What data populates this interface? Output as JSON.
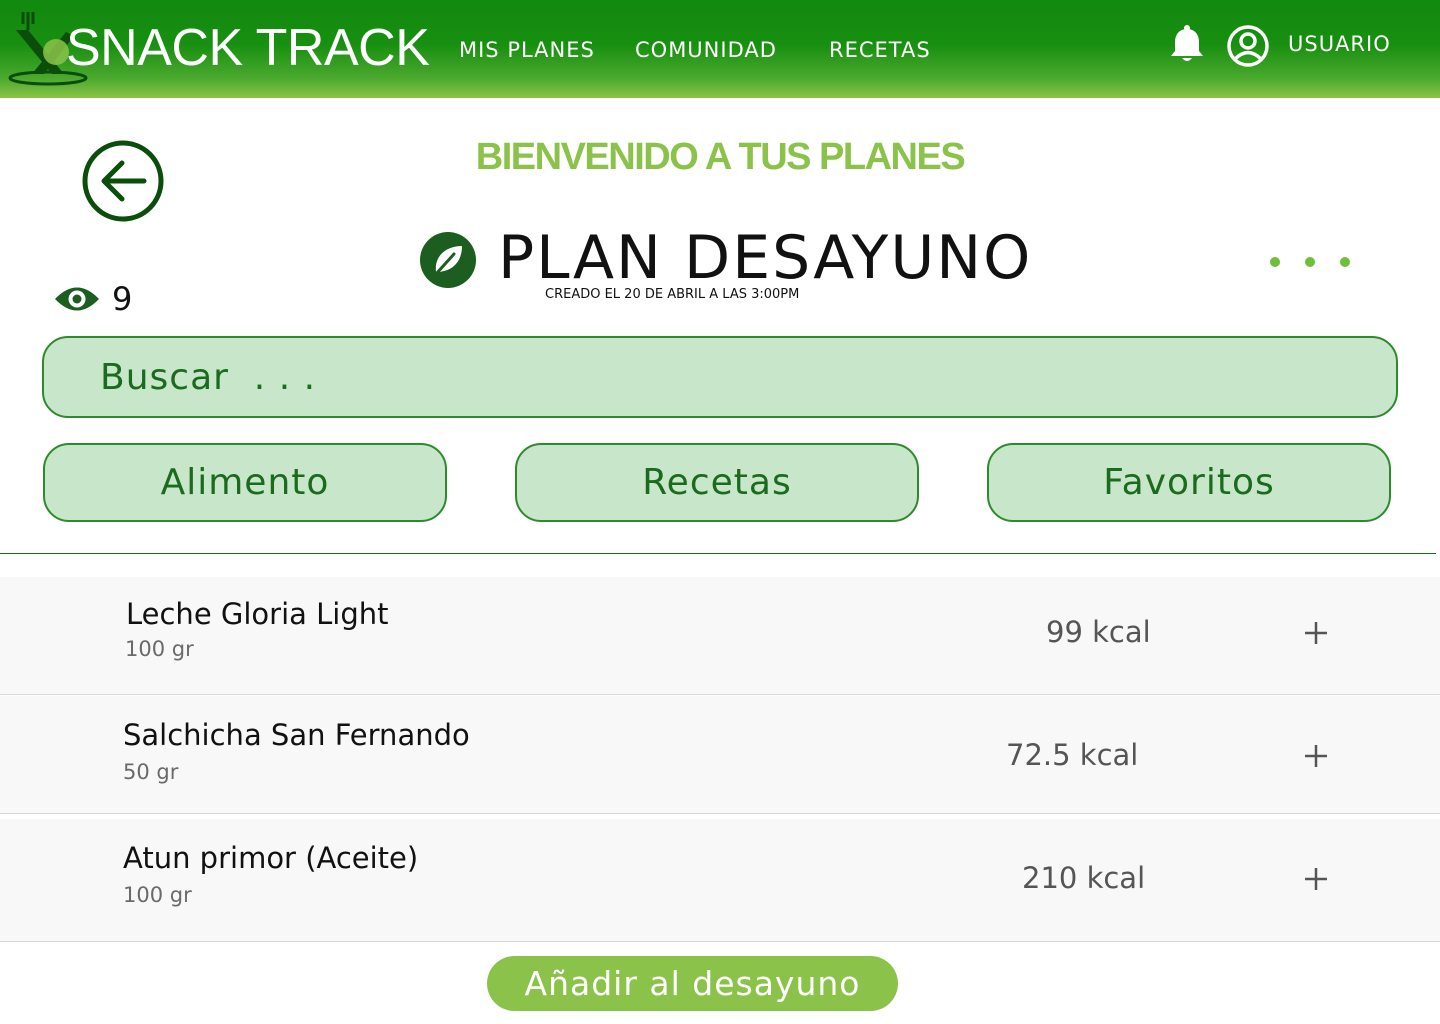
{
  "header": {
    "brand": "SNACK TRACK",
    "nav": {
      "mis_planes": "MIS PLANES",
      "comunidad": "COMUNIDAD",
      "recetas": "RECETAS"
    },
    "user_label": "USUARIO",
    "icons": [
      "logo-icon",
      "bell-icon",
      "user-circle-icon"
    ]
  },
  "page": {
    "welcome": "BIENVENIDO A TUS PLANES",
    "plan_title": "PLAN DESAYUNO",
    "plan_created": "CREADO EL 20 DE ABRIL A LAS 3:00PM",
    "views": "9"
  },
  "search": {
    "placeholder": "Buscar  . . ."
  },
  "filters": {
    "alimento": "Alimento",
    "recetas": "Recetas",
    "favoritos": "Favoritos"
  },
  "foods": [
    {
      "name": "Leche Gloria Light",
      "qty": "100 gr",
      "kcal": "99 kcal"
    },
    {
      "name": "Salchicha San Fernando",
      "qty": "50 gr",
      "kcal": "72.5 kcal"
    },
    {
      "name": "Atun primor (Aceite)",
      "qty": "100 gr",
      "kcal": "210 kcal"
    }
  ],
  "add_button": "Añadir al desayuno",
  "colors": {
    "header_green": "#12890f",
    "accent_light_green": "#8bc34a",
    "dark_green": "#1b5e20",
    "pill_fill": "#c8e6c9",
    "pill_border": "#2e8b2b"
  }
}
